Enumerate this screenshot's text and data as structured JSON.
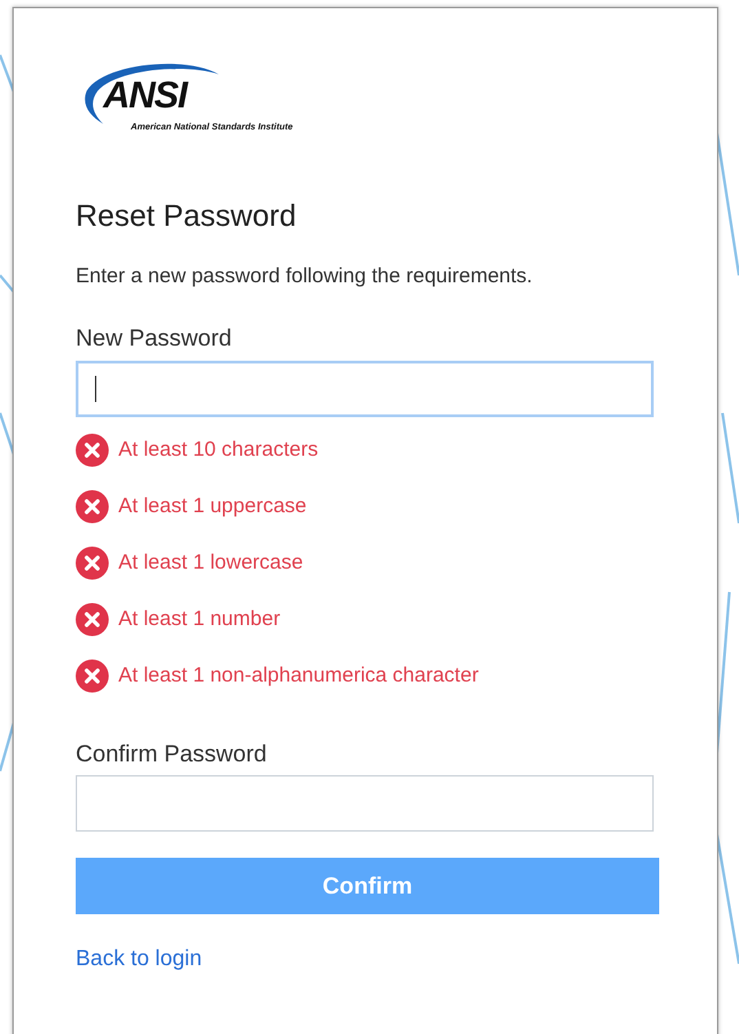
{
  "logo": {
    "mark": "ANSI",
    "subtitle": "American National Standards Institute"
  },
  "title": "Reset Password",
  "instructions": "Enter a new password following the requirements.",
  "new_password": {
    "label": "New Password",
    "focused": true
  },
  "requirements": [
    {
      "text": "At least 10 characters",
      "met": false
    },
    {
      "text": "At least 1 uppercase",
      "met": false
    },
    {
      "text": "At least 1 lowercase",
      "met": false
    },
    {
      "text": "At least 1 number",
      "met": false
    },
    {
      "text": "At least 1 non-alphanumerica character",
      "met": false
    }
  ],
  "confirm_password": {
    "label": "Confirm Password",
    "focused": false
  },
  "confirm_button": {
    "label": "Confirm",
    "disabled": true
  },
  "back_link": "Back to login"
}
